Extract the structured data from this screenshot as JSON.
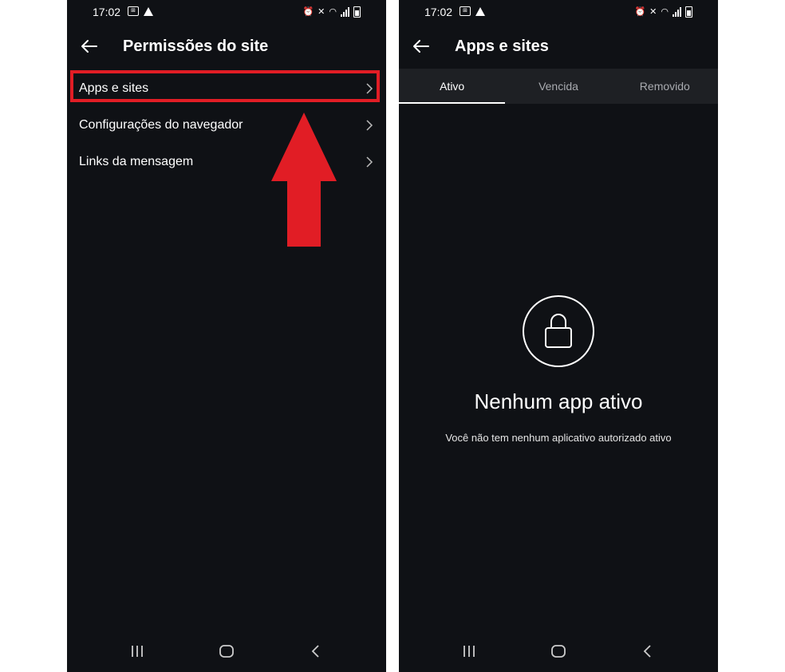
{
  "left_screen": {
    "status": {
      "time": "17:02"
    },
    "title": "Permissões do site",
    "menu": [
      {
        "label": "Apps e sites"
      },
      {
        "label": "Configurações do navegador"
      },
      {
        "label": "Links da mensagem"
      }
    ]
  },
  "right_screen": {
    "status": {
      "time": "17:02"
    },
    "title": "Apps e sites",
    "tabs": [
      {
        "label": "Ativo",
        "active": true
      },
      {
        "label": "Vencida",
        "active": false
      },
      {
        "label": "Removido",
        "active": false
      }
    ],
    "empty_state": {
      "title": "Nenhum app ativo",
      "subtitle": "Você não tem nenhum aplicativo autorizado ativo"
    }
  },
  "colors": {
    "background": "#0f1115",
    "tab_bar": "#1e2024",
    "highlight": "#e11d25",
    "text": "#ffffff"
  },
  "icons": {
    "back": "arrow-left-icon",
    "chevron": "chevron-right-icon",
    "lock": "lock-icon",
    "nav_recents": "recents-icon",
    "nav_home": "home-icon",
    "nav_back": "back-chevron-icon"
  }
}
